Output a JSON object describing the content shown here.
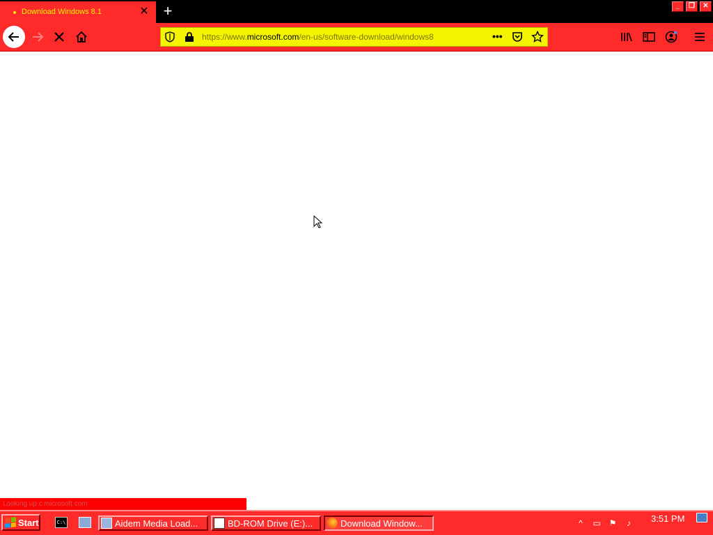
{
  "tab": {
    "title": "Download Windows 8.1",
    "close": "✕"
  },
  "new_tab": "+",
  "window_controls": {
    "minimize": "_",
    "maximize": "❐",
    "close": "✕"
  },
  "nav": {
    "back_icon": "arrow-left-icon",
    "forward_icon": "arrow-right-icon",
    "stop_icon": "stop-icon",
    "home_icon": "home-icon"
  },
  "url": {
    "prefix": "https://www.",
    "host": "microsoft.com",
    "path": "/en-us/software-download/windows8",
    "more": "•••"
  },
  "status_text": "Looking up c.microsoft.com",
  "taskbar": {
    "start_label": "Start",
    "tasks": [
      {
        "label": "Aidem Media Load...",
        "icon": "media-icon"
      },
      {
        "label": "BD-ROM Drive (E:)...",
        "icon": "drive-icon"
      },
      {
        "label": "Download Window...",
        "icon": "firefox-icon"
      }
    ],
    "clock": "3:51 PM"
  },
  "colors": {
    "accent": "#ff2a2a",
    "url_bg": "#f4f400",
    "tabstrip": "#000000"
  }
}
